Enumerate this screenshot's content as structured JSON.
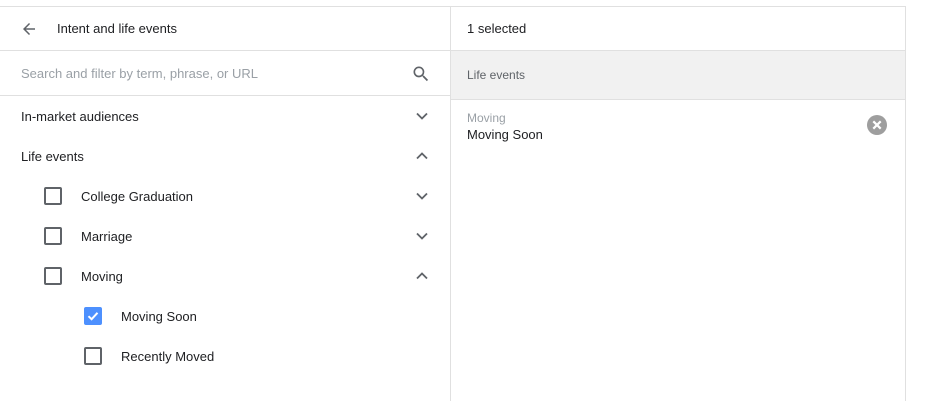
{
  "left_panel": {
    "title": "Intent and life events",
    "search": {
      "placeholder": "Search and filter by term, phrase, or URL",
      "value": ""
    },
    "tree": {
      "in_market": {
        "label": "In-market audiences",
        "expanded": false
      },
      "life_events": {
        "label": "Life events",
        "expanded": true,
        "children": [
          {
            "label": "College Graduation",
            "checked": false,
            "expanded": false
          },
          {
            "label": "Marriage",
            "checked": false,
            "expanded": false
          },
          {
            "label": "Moving",
            "checked": false,
            "expanded": true,
            "children": [
              {
                "label": "Moving Soon",
                "checked": true
              },
              {
                "label": "Recently Moved",
                "checked": false
              }
            ]
          }
        ]
      }
    }
  },
  "right_panel": {
    "selected_count": "1 selected",
    "group_label": "Life events",
    "items": [
      {
        "parent": "Moving",
        "name": "Moving Soon"
      }
    ]
  },
  "icons": {
    "back": "arrow-back-icon",
    "search": "search-icon",
    "expand": "chevron-down-icon",
    "collapse": "chevron-up-icon",
    "remove": "close-circle-icon"
  },
  "colors": {
    "accent": "#4d90fe",
    "divider": "#e0e0e0",
    "group_bg": "#f1f1f1"
  }
}
